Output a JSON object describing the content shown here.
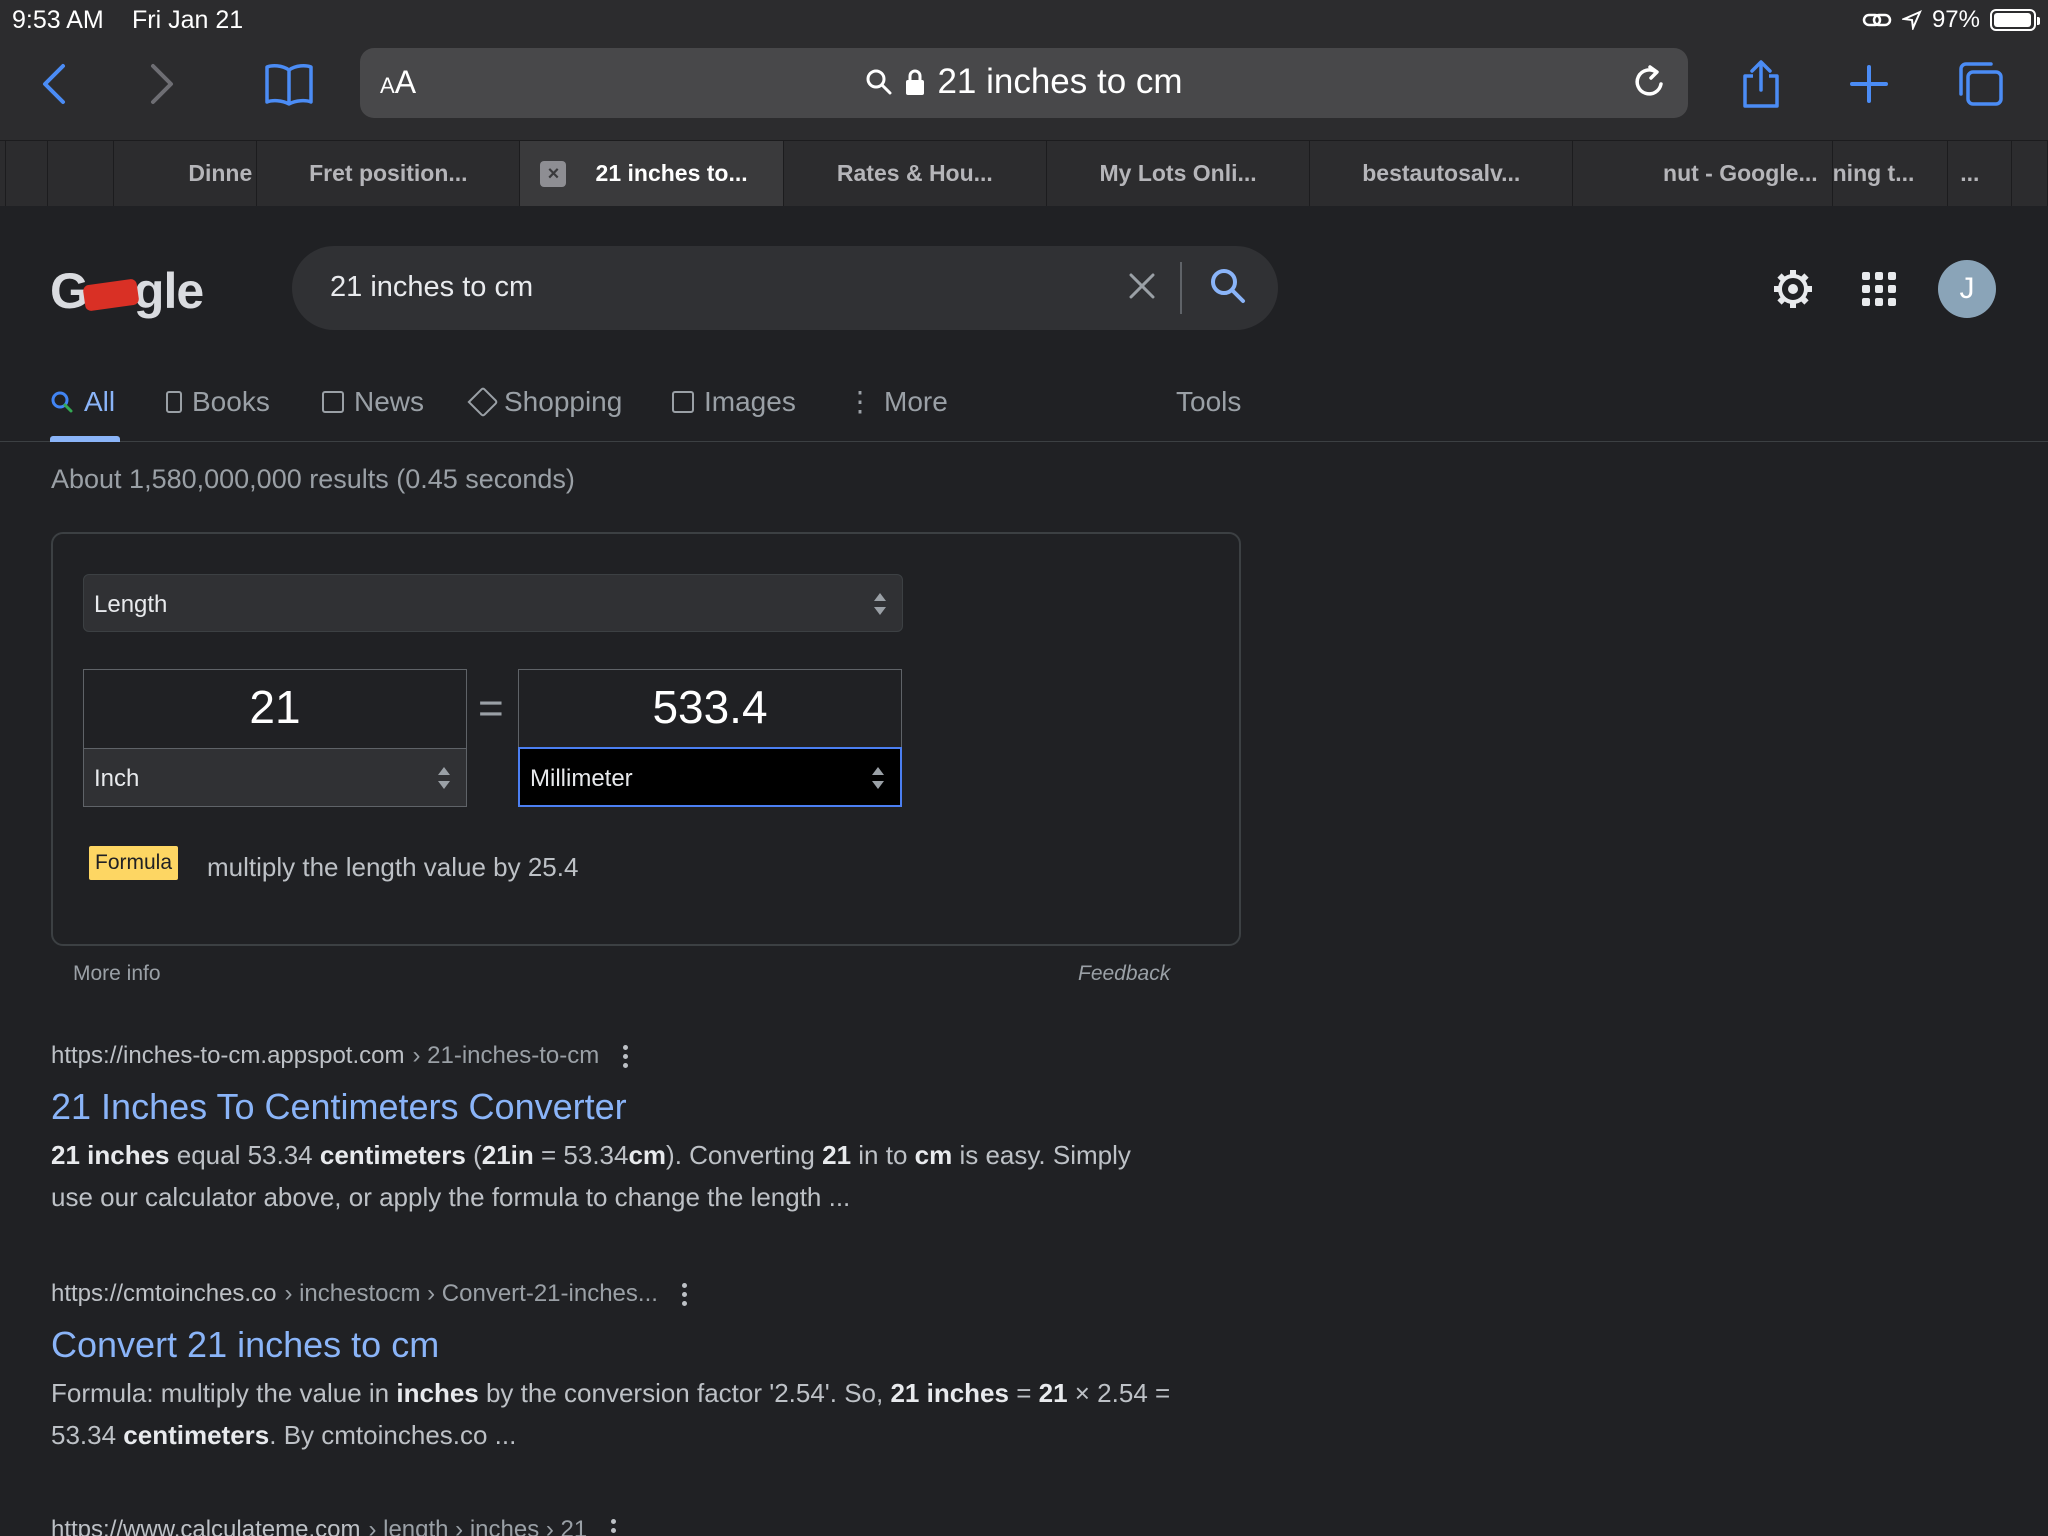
{
  "status": {
    "time": "9:53 AM",
    "date": "Fri Jan 21",
    "battery_percent": "97%",
    "battery_level": 0.97
  },
  "safari": {
    "aa_label": "AA",
    "address": "21 inches to cm",
    "tabs": [
      {
        "label": "Dinne",
        "active": false
      },
      {
        "label": "Fret position...",
        "active": false
      },
      {
        "label": "21 inches to...",
        "active": true
      },
      {
        "label": "Rates & Hou...",
        "active": false
      },
      {
        "label": "My Lots Onli...",
        "active": false
      },
      {
        "label": "bestautosalv...",
        "active": false
      },
      {
        "label": "nut - Google...",
        "active": false
      },
      {
        "label": "ning t...",
        "active": false
      },
      {
        "label": "...",
        "active": false
      }
    ]
  },
  "google": {
    "logo_text": "Google",
    "query": "21 inches to cm",
    "avatar_initial": "J",
    "tabs": {
      "all": "All",
      "books": "Books",
      "news": "News",
      "shopping": "Shopping",
      "images": "Images",
      "more": "More",
      "tools": "Tools"
    },
    "result_stats": "About 1,580,000,000 results (0.45 seconds)",
    "converter": {
      "unit_type": "Length",
      "from_value": "21",
      "from_unit": "Inch",
      "equals": "=",
      "to_value": "533.4",
      "to_unit": "Millimeter",
      "formula_label": "Formula",
      "formula_text": "multiply the length value by 25.4",
      "more_info": "More info",
      "feedback": "Feedback"
    },
    "results": [
      {
        "url_host": "https://inches-to-cm.appspot.com",
        "url_path": "› 21-inches-to-cm",
        "title": "21 Inches To Centimeters Converter",
        "snippet_parts": {
          "p1": "21 inches",
          "p2": " equal 53.34 ",
          "p3": "centimeters",
          "p4": " (",
          "p5": "21in",
          "p6": " = 53.34",
          "p7": "cm",
          "p8": "). Converting ",
          "p9": "21",
          "p10": " in to ",
          "p11": "cm",
          "p12": " is easy. Simply use our calculator above, or apply the formula to change the length ..."
        }
      },
      {
        "url_host": "https://cmtoinches.co",
        "url_path": "› inchestocm › Convert-21-inches...",
        "title": "Convert 21 inches to cm",
        "snippet_parts": {
          "p1": "Formula: multiply the value in ",
          "p2": "inches",
          "p3": " by the conversion factor '2.54'. So, ",
          "p4": "21 inches",
          "p5": " = ",
          "p6": "21",
          "p7": " × 2.54 = 53.34 ",
          "p8": "centimeters",
          "p9": ". By cmtoinches.co ..."
        }
      },
      {
        "url_host": "https://www.calculateme.com",
        "url_path": "› length › inches › 21"
      }
    ]
  }
}
